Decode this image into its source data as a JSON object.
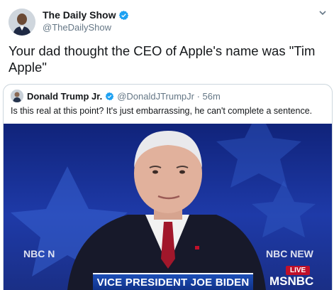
{
  "tweet": {
    "display_name": "The Daily Show",
    "handle": "@TheDailyShow",
    "text": "Your dad thought the CEO of Apple's name was \"Tim Apple\""
  },
  "quote_tweet": {
    "display_name": "Donald Trump Jr.",
    "handle": "@DonaldJTrumpJr · 56m",
    "text": "Is this real at this point? It's just embarrassing, he can't complete a sentence."
  },
  "video": {
    "lower_third": "VICE PRESIDENT JOE BIDEN",
    "logo_left": "NBC N",
    "logo_right": "NBC NEW",
    "live_badge": "LIVE",
    "network": "MSNBC"
  },
  "colors": {
    "verified": "#1da1f2",
    "text": "#14171a",
    "muted": "#657786",
    "live_red": "#c0102a"
  },
  "icons": [
    "verified-badge-icon",
    "chevron-down-icon"
  ]
}
